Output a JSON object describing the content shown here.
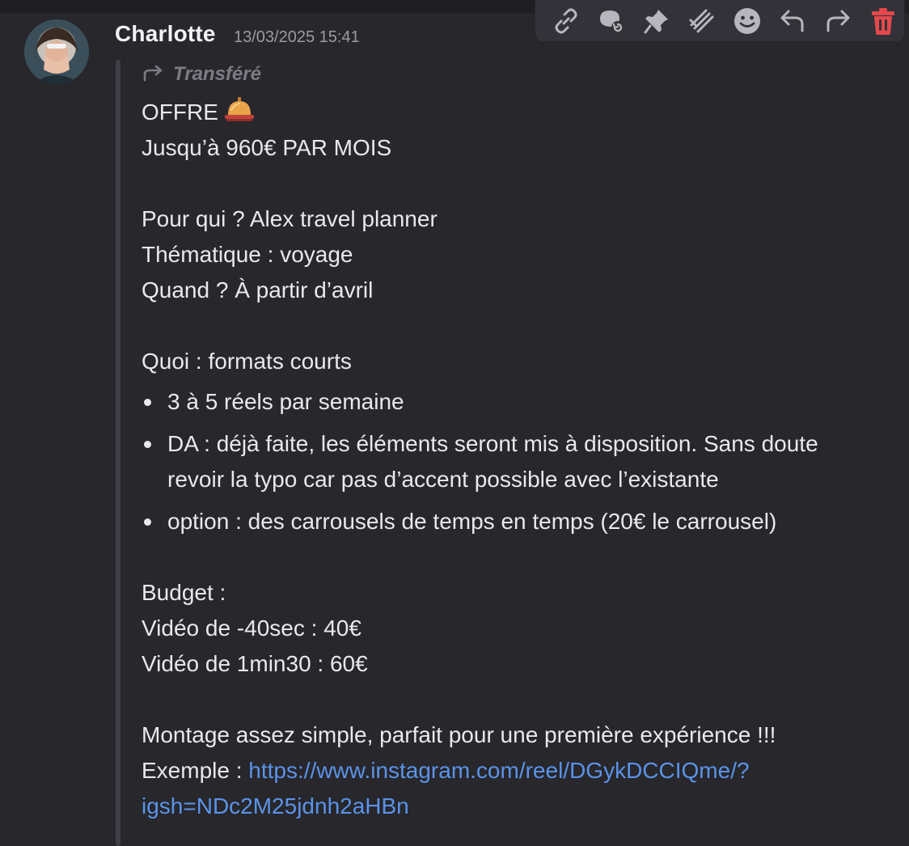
{
  "message": {
    "author": "Charlotte",
    "timestamp": "13/03/2025 15:41",
    "forwarded_label": "Transféré",
    "lines": {
      "l1": "OFFRE",
      "l2": "Jusqu’à 960€ PAR MOIS",
      "l3": "Pour qui ? Alex travel planner",
      "l4": "Thématique : voyage",
      "l5": "Quand ? À partir d’avril",
      "l6": "Quoi : formats courts",
      "b1": "3 à 5 réels par semaine",
      "b2a": "DA : déjà faite, les éléments seront mis à disposition. Sans doute",
      "b2b": "revoir la typo car pas d’accent possible avec l’existante",
      "b3": "option : des carrousels de temps en temps (20€ le carrousel)",
      "l7": "Budget :",
      "l8": "Vidéo de -40sec : 40€",
      "l9": "Vidéo de 1min30 : 60€",
      "l10": "Montage assez simple, parfait pour une première expérience !!!",
      "l11_prefix": "Exemple : ",
      "link_part1": "https://www.instagram.com/reel/DGykDCCIQme/?",
      "link_part2": "igsh=NDc2M25jdnh2aHBn"
    }
  },
  "toolbar": {
    "icons": [
      "link-icon",
      "thread-icon",
      "pin-icon",
      "forward-stack-icon",
      "emoji-icon",
      "reply-icon",
      "forward-icon",
      "delete-icon"
    ]
  },
  "colors": {
    "background": "#27272c",
    "link": "#5b93e8",
    "delete": "#e5484d"
  }
}
